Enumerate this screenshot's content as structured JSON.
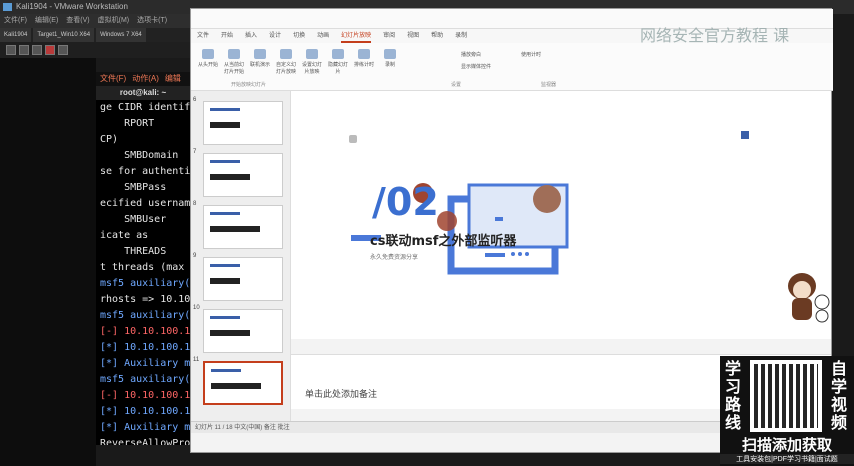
{
  "vmware": {
    "title": "Kali1904 - VMware Workstation",
    "menu": [
      "文件(F)",
      "编辑(E)",
      "查看(V)",
      "虚拟机(M)",
      "选项卡(T)"
    ],
    "tabs": [
      "Kali1904",
      "Target1_Win10 X64",
      "Windows 7 X64"
    ]
  },
  "terminal": {
    "menu": [
      "文件(F)",
      "动作(A)",
      "编辑"
    ],
    "title": "root@kali: ~",
    "lines": [
      {
        "text": "ge CIDR identif",
        "kind": "normal"
      },
      {
        "text": "    RPORT",
        "kind": "normal"
      },
      {
        "text": "CP)",
        "kind": "normal"
      },
      {
        "text": "    SMBDomain",
        "kind": "normal"
      },
      {
        "text": "se for authenti",
        "kind": "normal"
      },
      {
        "text": "    SMBPass",
        "kind": "normal"
      },
      {
        "text": "ecified usernam",
        "kind": "normal"
      },
      {
        "text": "    SMBUser",
        "kind": "normal"
      },
      {
        "text": "icate as",
        "kind": "normal"
      },
      {
        "text": "    THREADS",
        "kind": "normal"
      },
      {
        "text": "t threads (max",
        "kind": "normal"
      },
      {
        "text": "",
        "kind": "normal"
      },
      {
        "text": "msf5 auxiliary(",
        "kind": "prompt"
      },
      {
        "text": "rhosts => 10.10",
        "kind": "normal"
      },
      {
        "text": "msf5 auxiliary(",
        "kind": "prompt"
      },
      {
        "text": "",
        "kind": "normal"
      },
      {
        "text": "[-] 10.10.100.1",
        "kind": "err"
      },
      {
        "text": "[*] 10.10.100.1",
        "kind": "info"
      },
      {
        "text": "[*] Auxiliary m",
        "kind": "info"
      },
      {
        "text": "msf5 auxiliary(",
        "kind": "prompt"
      },
      {
        "text": "",
        "kind": "normal"
      },
      {
        "text": "[-] 10.10.100.1",
        "kind": "err"
      },
      {
        "text": "[*] 10.10.100.1",
        "kind": "info"
      },
      {
        "text": "[*] Auxiliary m",
        "kind": "info"
      },
      {
        "text": "ReverseAllowPro",
        "kind": "normal"
      },
      {
        "text": "msf5 auxiliary(",
        "kind": "prompt"
      }
    ]
  },
  "ppt": {
    "tabs": [
      "文件",
      "开始",
      "插入",
      "设计",
      "切换",
      "动画",
      "幻灯片放映",
      "审阅",
      "视图",
      "帮助",
      "录制"
    ],
    "active_tab": "幻灯片放映",
    "ribbon": {
      "buttons": [
        "从头开始",
        "从当前幻灯片开始",
        "联机演示",
        "自定义幻灯片放映",
        "设置幻灯片放映",
        "隐藏幻灯片",
        "排练计时",
        "录制"
      ],
      "checks": [
        "播放旁白",
        "使用计时",
        "显示媒体控件"
      ],
      "groups": [
        "开始放映幻灯片",
        "设置",
        "监视器"
      ]
    },
    "thumb_numbers": [
      "6",
      "7",
      "8",
      "9",
      "10",
      "11"
    ],
    "slide": {
      "number": "/02",
      "title": "cs联动msf之外部监听器",
      "subtitle": "永久免费资源分享"
    },
    "notes_placeholder": "单击此处添加备注",
    "status": "幻灯片 11 / 18    中文(中国)    备注    批注"
  },
  "watermark": "网络安全官方教程 课",
  "promo": {
    "left_text": [
      "学",
      "习",
      "路",
      "线"
    ],
    "right_text": [
      "自",
      "学",
      "视",
      "频"
    ],
    "cta": "扫描添加获取",
    "footer": "工具安装包|PDF学习书籍|面试题"
  },
  "colors": {
    "accent_blue": "#3b6fd0",
    "accent_orange": "#c43e1c"
  }
}
